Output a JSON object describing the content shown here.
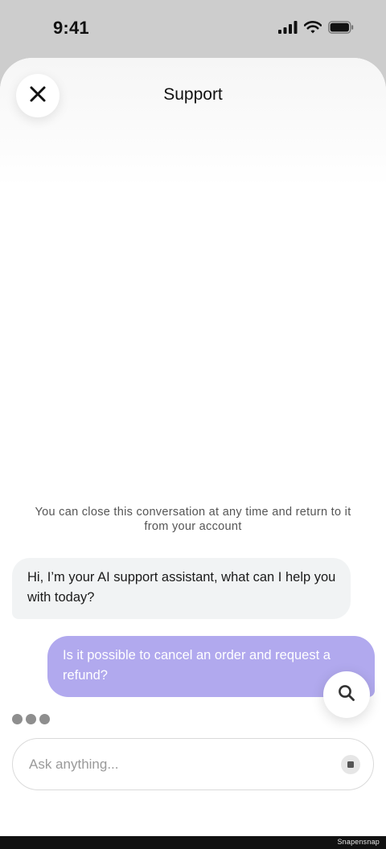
{
  "status_bar": {
    "time": "9:41",
    "icons": [
      "cellular-signal-icon",
      "wifi-icon",
      "battery-icon"
    ]
  },
  "header": {
    "title": "Support",
    "close_icon": "close-icon"
  },
  "notice": "You can close this conversation at any time and return to it from your account",
  "messages": [
    {
      "role": "assistant",
      "text": "Hi, I’m your AI support assistant, what can I help you with today?"
    },
    {
      "role": "user",
      "text": "Is it possible to cancel an order and request a refund?"
    }
  ],
  "composer": {
    "placeholder": "Ask anything...",
    "value": ""
  },
  "watermark": "Snapensnap",
  "colors": {
    "user_bubble": "#b1a9ee",
    "assistant_bubble": "#f1f3f4",
    "backdrop": "#cdcdcd"
  }
}
